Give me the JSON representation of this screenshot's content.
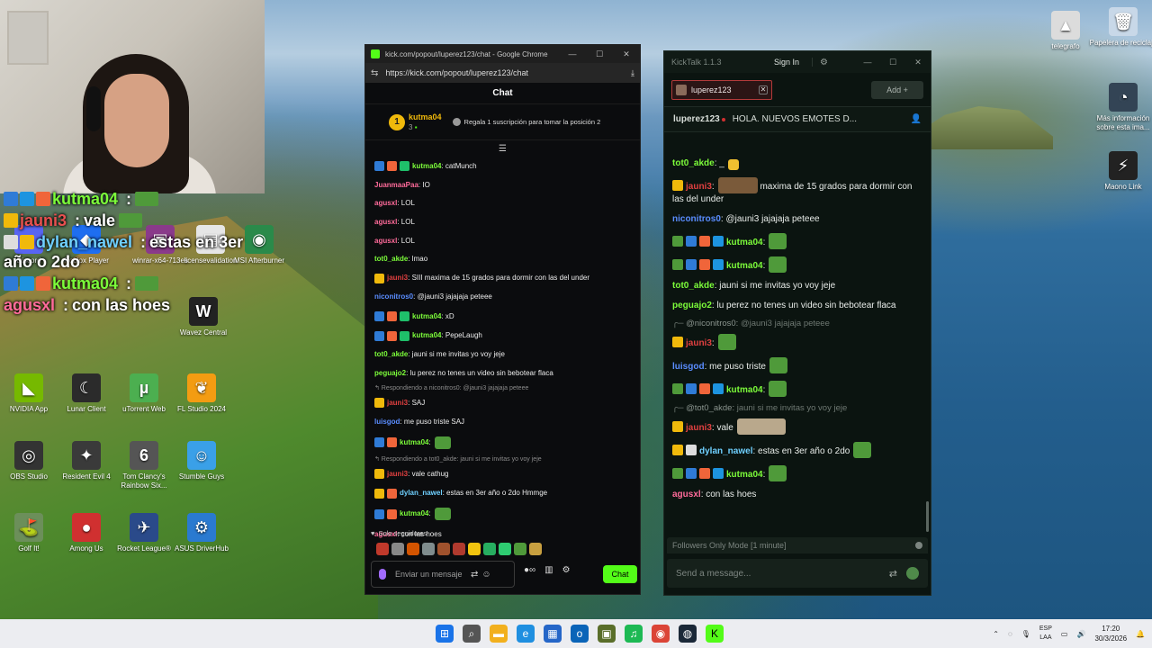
{
  "webcam": {},
  "desktop_icons": [
    {
      "label": "Discord",
      "color": "#5865f2",
      "glyph": "◐"
    },
    {
      "label": "Roblox Player",
      "color": "#1e6ef0",
      "glyph": "◆"
    },
    {
      "label": "winrar-x64-713es",
      "color": "#8a3a8a",
      "glyph": "▣"
    },
    {
      "label": "licensevalidation",
      "color": "#e6e6e6",
      "glyph": "▤"
    },
    {
      "label": "MSI Afterburner",
      "color": "#2a8a4a",
      "glyph": "◉"
    },
    {
      "label": "Wavez Central",
      "color": "#222222",
      "glyph": "W"
    },
    {
      "label": "NVIDIA App",
      "color": "#76b900",
      "glyph": "◣"
    },
    {
      "label": "Lunar Client",
      "color": "#2b2b2b",
      "glyph": "☾"
    },
    {
      "label": "uTorrent Web",
      "color": "#4caf50",
      "glyph": "µ"
    },
    {
      "label": "FL Studio 2024",
      "color": "#f39c12",
      "glyph": "❦"
    },
    {
      "label": "OBS Studio",
      "color": "#333333",
      "glyph": "◎"
    },
    {
      "label": "Resident Evil 4",
      "color": "#3a3a3a",
      "glyph": "✦"
    },
    {
      "label": "Tom Clancy's Rainbow Six...",
      "color": "#555555",
      "glyph": "6"
    },
    {
      "label": "Stumble Guys",
      "color": "#3aa0e8",
      "glyph": "☺"
    },
    {
      "label": "Golf It!",
      "color": "#6c8f5a",
      "glyph": "⛳"
    },
    {
      "label": "Among Us",
      "color": "#d03030",
      "glyph": "●"
    },
    {
      "label": "Rocket League®",
      "color": "#2a4a8a",
      "glyph": "✈"
    },
    {
      "label": "ASUS DriverHub",
      "color": "#2a7ad0",
      "glyph": "⚙"
    },
    {
      "label": "telegrafo",
      "color": "#dcdcdc",
      "glyph": "▲"
    },
    {
      "label": "Papelera de reciclaje",
      "color": "#c8d8e8",
      "glyph": "🗑"
    },
    {
      "label": "Más información sobre esta ima...",
      "color": "#334455",
      "glyph": "◔"
    },
    {
      "label": "Maono Link",
      "color": "#222222",
      "glyph": "⚡"
    }
  ],
  "overlay_chat": [
    {
      "user": "kutma04",
      "sep": " :",
      "text": "",
      "user_color": "#7cfc3a",
      "badges": [
        "#2f7bd6",
        "#1d94e0",
        "#f0653a"
      ],
      "emote": true
    },
    {
      "user": "jauni3",
      "sep": " :",
      "text": "vale",
      "user_color": "#e85050",
      "badges": [
        "#f0b90b"
      ],
      "emote": true
    },
    {
      "user": "dylan_nawel",
      "sep": " :",
      "text": "estas en 3er año o 2do",
      "user_color": "#6fd0ff",
      "badges": [
        "#dddddd",
        "#f0b90b"
      ],
      "emote": false
    },
    {
      "user": "kutma04",
      "sep": " :",
      "text": "",
      "user_color": "#7cfc3a",
      "badges": [
        "#2f7bd6",
        "#1d94e0",
        "#f0653a"
      ],
      "emote": true
    },
    {
      "user": "agusxl",
      "sep": " :",
      "text": "con las hoes",
      "user_color": "#ff6b9a",
      "badges": [],
      "emote": false
    }
  ],
  "chrome_window": {
    "title": "kick.com/popout/luperez123/chat - Google Chrome",
    "url": "https://kick.com/popout/luperez123/chat",
    "header": "Chat",
    "pinned": {
      "rank": "1",
      "user": "kutma04",
      "count": "3",
      "gift_text": "Regala 1 suscripción para tomar la posición 2"
    },
    "messages": [
      {
        "type": "msg",
        "badges": [
          "kb-pick",
          "kb-o",
          "kb-gift"
        ],
        "user": "kutma04",
        "user_color": "#7cfc3a",
        "text": ": catMunch",
        "emote": false
      },
      {
        "type": "msg",
        "badges": [],
        "user": "JuanmaaPaa",
        "user_color": "#ff6b9a",
        "text": ": IO",
        "emote": false
      },
      {
        "type": "msg",
        "badges": [],
        "user": "agusxl",
        "user_color": "#ff6b9a",
        "text": ": LOL",
        "emote": false
      },
      {
        "type": "msg",
        "badges": [],
        "user": "agusxl",
        "user_color": "#ff6b9a",
        "text": ": LOL",
        "emote": false
      },
      {
        "type": "msg",
        "badges": [],
        "user": "agusxl",
        "user_color": "#ff6b9a",
        "text": ": LOL",
        "emote": false
      },
      {
        "type": "msg",
        "badges": [],
        "user": "tot0_akde",
        "user_color": "#7cfc3a",
        "text": ": lmao",
        "emote": false
      },
      {
        "type": "msg",
        "badges": [
          "kb-crown"
        ],
        "user": "jauni3",
        "user_color": "#e04040",
        "text": ": SIII maxima de 15 grados para dormir con las del under",
        "emote": false
      },
      {
        "type": "msg",
        "badges": [],
        "user": "niconitros0",
        "user_color": "#5a8dff",
        "text": ": @jauni3 jajajaja peteee",
        "emote": false
      },
      {
        "type": "msg",
        "badges": [
          "kb-pick",
          "kb-o",
          "kb-gift"
        ],
        "user": "kutma04",
        "user_color": "#7cfc3a",
        "text": ": xD",
        "emote": false
      },
      {
        "type": "msg",
        "badges": [
          "kb-pick",
          "kb-o",
          "kb-gift"
        ],
        "user": "kutma04",
        "user_color": "#7cfc3a",
        "text": ": PepeLaugh",
        "emote": false
      },
      {
        "type": "msg",
        "badges": [],
        "user": "tot0_akde",
        "user_color": "#7cfc3a",
        "text": ": jauni si me invitas yo voy jeje",
        "emote": false
      },
      {
        "type": "msg",
        "badges": [],
        "user": "peguajo2",
        "user_color": "#7cfc3a",
        "text": ": lu perez no tenes un video sin bebotear flaca",
        "emote": false
      },
      {
        "type": "reply",
        "text": "↰ Respondiendo a niconitros0: @jauni3 jajajaja peteee"
      },
      {
        "type": "msg",
        "badges": [
          "kb-crown"
        ],
        "user": "jauni3",
        "user_color": "#e04040",
        "text": ": SAJ",
        "emote": false
      },
      {
        "type": "msg",
        "badges": [],
        "user": "luisgod",
        "user_color": "#5a8dff",
        "text": ": me puso triste SAJ",
        "emote": false
      },
      {
        "type": "msg",
        "badges": [
          "kb-pick",
          "kb-o"
        ],
        "user": "kutma04",
        "user_color": "#7cfc3a",
        "text": ":",
        "emote": true
      },
      {
        "type": "reply",
        "text": "↰ Respondiendo a tot0_akde: jauni si me invitas yo voy jeje"
      },
      {
        "type": "msg",
        "badges": [
          "kb-crown"
        ],
        "user": "jauni3",
        "user_color": "#e04040",
        "text": ": vale cathug",
        "emote": false
      },
      {
        "type": "msg",
        "badges": [
          "kb-crown",
          "kb-o"
        ],
        "user": "dylan_nawel",
        "user_color": "#6fd0ff",
        "text": ": estas en 3er año o 2do Hmmge",
        "emote": false
      },
      {
        "type": "msg",
        "badges": [
          "kb-pick",
          "kb-o"
        ],
        "user": "kutma04",
        "user_color": "#7cfc3a",
        "text": ":",
        "emote": true
      },
      {
        "type": "msg",
        "badges": [],
        "user": "agusxl",
        "user_color": "#ff6b9a",
        "text": ": con las hoes",
        "emote": false
      }
    ],
    "followers_only": "Solo seguidores",
    "emote_colors": [
      "#c0392b",
      "#888888",
      "#d35400",
      "#7f8c8d",
      "#a0522d",
      "#b03a2e",
      "#f1c40f",
      "#27ae60",
      "#2ecc71",
      "#4f9a3a",
      "#c8a040"
    ],
    "input_placeholder": "Enviar un mensaje",
    "chat_button": "Chat"
  },
  "kicktalk": {
    "title": "KickTalk 1.1.3",
    "sign_in": "Sign In",
    "tab_label": "luperez123",
    "add_label": "Add +",
    "stream_channel": "luperez123",
    "stream_title": "HOLA. NUEVOS EMOTES D...",
    "messages": [
      {
        "type": "msg",
        "badges": [],
        "user": "tot0_akde",
        "user_color": "#7cfc3a",
        "text": " _",
        "emote": "small"
      },
      {
        "type": "msg",
        "badges": [
          "#f0b90b"
        ],
        "user": "jauni3",
        "user_color": "#e04040",
        "text": " maxima de 15 grados para dormir con las del under",
        "emote": "pre"
      },
      {
        "type": "msg",
        "badges": [],
        "user": "niconitros0",
        "user_color": "#5a8dff",
        "text": " @jauni3 jajajaja peteee",
        "emote": ""
      },
      {
        "type": "msg",
        "badges": [
          "#4f9a3a",
          "#2f7bd6",
          "#f0653a",
          "#1d94e0"
        ],
        "user": "kutma04",
        "user_color": "#7cfc3a",
        "text": "",
        "emote": "pepe"
      },
      {
        "type": "msg",
        "badges": [
          "#4f9a3a",
          "#2f7bd6",
          "#f0653a",
          "#1d94e0"
        ],
        "user": "kutma04",
        "user_color": "#7cfc3a",
        "text": "",
        "emote": "pepe"
      },
      {
        "type": "msg",
        "badges": [],
        "user": "tot0_akde",
        "user_color": "#7cfc3a",
        "text": " jauni si me invitas yo voy jeje",
        "emote": ""
      },
      {
        "type": "msg",
        "badges": [],
        "user": "peguajo2",
        "user_color": "#7cfc3a",
        "text": " lu perez no tenes un video sin bebotear flaca",
        "emote": ""
      },
      {
        "type": "reply",
        "reply_user": "@niconitros0:",
        "text": " @jauni3 jajajaja peteee"
      },
      {
        "type": "msg",
        "badges": [
          "#f0b90b"
        ],
        "user": "jauni3",
        "user_color": "#e04040",
        "text": "",
        "emote": "pepe"
      },
      {
        "type": "msg",
        "badges": [],
        "user": "luisgod",
        "user_color": "#5a8dff",
        "text": " me puso triste",
        "emote": "pepe"
      },
      {
        "type": "msg",
        "badges": [
          "#4f9a3a",
          "#2f7bd6",
          "#f0653a",
          "#1d94e0"
        ],
        "user": "kutma04",
        "user_color": "#7cfc3a",
        "text": "",
        "emote": "pepe"
      },
      {
        "type": "reply",
        "reply_user": "@tot0_akde:",
        "text": " jauni si me invitas yo voy jeje"
      },
      {
        "type": "msg",
        "badges": [
          "#f0b90b"
        ],
        "user": "jauni3",
        "user_color": "#e04040",
        "text": " vale",
        "emote": "wide"
      },
      {
        "type": "msg",
        "badges": [
          "#f0b90b",
          "#dddddd"
        ],
        "user": "dylan_nawel",
        "user_color": "#6fd0ff",
        "text": " estas en 3er año o 2do",
        "emote": "pepe"
      },
      {
        "type": "msg",
        "badges": [
          "#4f9a3a",
          "#2f7bd6",
          "#f0653a",
          "#1d94e0"
        ],
        "user": "kutma04",
        "user_color": "#7cfc3a",
        "text": "",
        "emote": "pepe"
      },
      {
        "type": "msg",
        "badges": [],
        "user": "agusxl",
        "user_color": "#ff6b9a",
        "text": " con las hoes",
        "emote": ""
      }
    ],
    "mode_text": "Followers Only Mode [1 minute]",
    "input_placeholder": "Send a message..."
  },
  "taskbar": {
    "apps": [
      {
        "name": "start",
        "color": "#1a73e8",
        "glyph": "⊞"
      },
      {
        "name": "search",
        "color": "#555555",
        "glyph": "⌕"
      },
      {
        "name": "file-explorer",
        "color": "#f2b01e",
        "glyph": "▬"
      },
      {
        "name": "edge",
        "color": "#1f8fe0",
        "glyph": "e"
      },
      {
        "name": "ms-store",
        "color": "#2566c8",
        "glyph": "▦"
      },
      {
        "name": "outlook",
        "color": "#0a64b8",
        "glyph": "o"
      },
      {
        "name": "game-app",
        "color": "#5a6e2a",
        "glyph": "▣"
      },
      {
        "name": "spotify",
        "color": "#1db954",
        "glyph": "♫"
      },
      {
        "name": "chrome",
        "color": "#db4437",
        "glyph": "◉"
      },
      {
        "name": "steam",
        "color": "#1b2838",
        "glyph": "◍"
      },
      {
        "name": "kick",
        "color": "#53fc18",
        "glyph": "K"
      }
    ],
    "lang_top": "ESP",
    "lang_bottom": "LAA",
    "time": "17:20",
    "date": "30/3/2026"
  }
}
